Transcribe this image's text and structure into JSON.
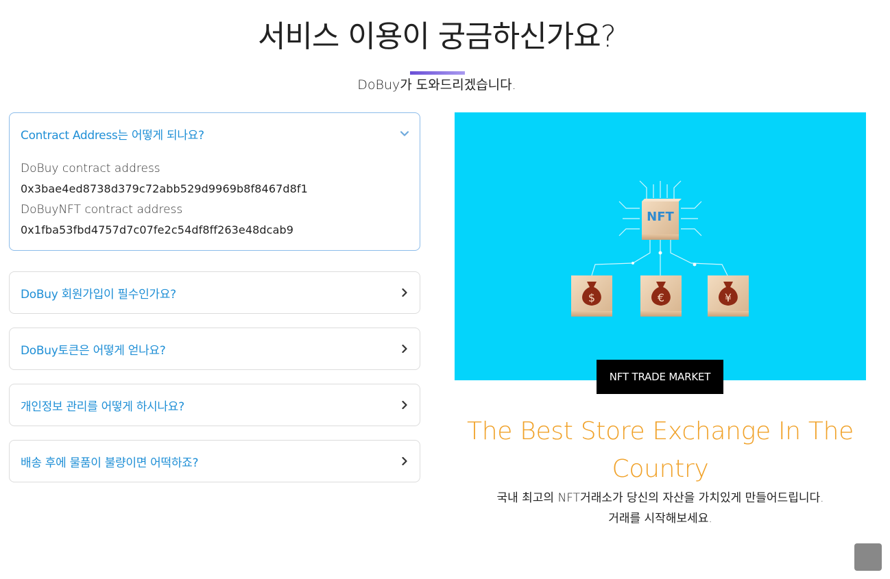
{
  "section": {
    "title": "서비스 이용이 궁금하신가요?",
    "subtitle": "DoBuy가 도와드리겠습니다."
  },
  "faq": [
    {
      "question": "Contract Address는 어떻게 되나요?",
      "expanded": true,
      "answer": {
        "label1": "DoBuy contract address",
        "address1": "0x3bae4ed8738d379c72abb529d9969b8f8467d8f1",
        "label2": "DoBuyNFT contract address",
        "address2": "0x1fba53fbd4757d7c07fe2c54df8ff263e48dcab9"
      }
    },
    {
      "question": "DoBuy 회원가입이 필수인가요?",
      "expanded": false
    },
    {
      "question": "DoBuy토큰은 어떻게 얻나요?",
      "expanded": false
    },
    {
      "question": "개인정보 관리를 어떻게 하시나요?",
      "expanded": false
    },
    {
      "question": "배송 후에 물품이 불량이면 어떡하죠?",
      "expanded": false
    }
  ],
  "hero": {
    "chip_label": "NFT",
    "currency_symbols": [
      "$",
      "€",
      "¥"
    ],
    "badge": "NFT TRADE MARKET",
    "headline": "The Best Store Exchange In The Country",
    "desc_line1": "국내 최고의 NFT거래소가 당신의 자산을 가치있게 만들어드립니다.",
    "desc_line2": "거래를 시작해보세요."
  },
  "colors": {
    "accent_blue": "#1f8fd6",
    "hero_bg": "#04d4fb",
    "headline_orange": "#f0a128",
    "title_bar_start": "#6a4fd6",
    "title_bar_end": "#a99af0"
  },
  "icons": {
    "expanded": "chevron-down-icon",
    "collapsed": "chevron-right-icon",
    "scroll_top": "scroll-top-button"
  }
}
